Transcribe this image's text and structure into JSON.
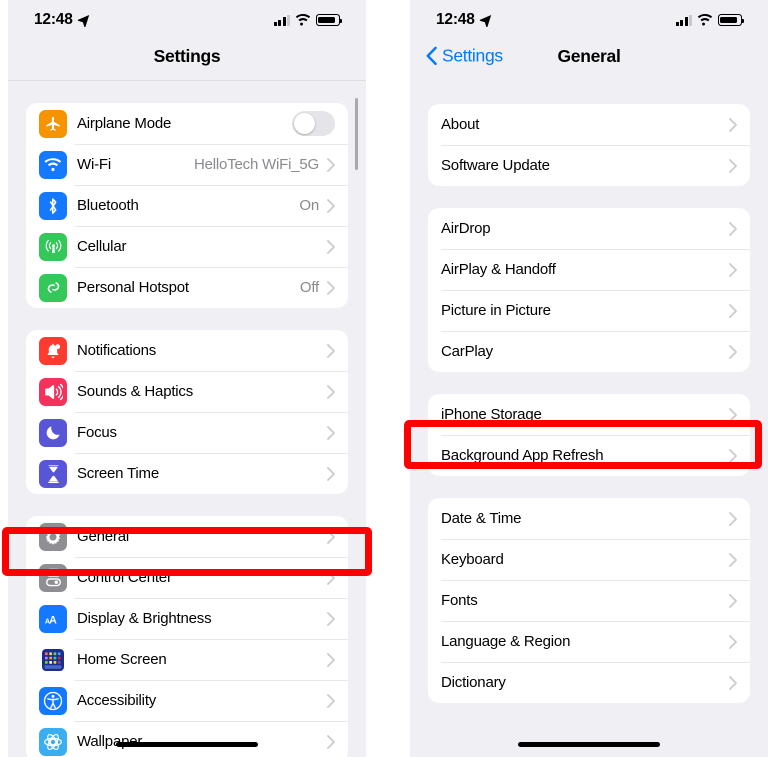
{
  "colors": {
    "accent_blue": "#007aff",
    "highlight_red": "#ff0000",
    "page_background": "#efeff4",
    "card_background": "#ffffff",
    "value_gray": "#8a8a8e"
  },
  "left_phone": {
    "status_bar": {
      "time": "12:48",
      "location_icon": "location-arrow-icon",
      "signal_icon": "cellular-bars-icon",
      "wifi_icon": "wifi-icon",
      "battery_icon": "battery-icon"
    },
    "nav": {
      "title": "Settings"
    },
    "groups": [
      {
        "rows": [
          {
            "label": "Airplane Mode",
            "icon": "airplane-icon",
            "icon_color": "#f59300",
            "control": "toggle",
            "toggle_on": false
          },
          {
            "label": "Wi-Fi",
            "icon": "wifi-icon",
            "icon_color": "#1479ff",
            "value": "HelloTech WiFi_5G",
            "control": "chevron"
          },
          {
            "label": "Bluetooth",
            "icon": "bluetooth-icon",
            "icon_color": "#1479ff",
            "value": "On",
            "control": "chevron"
          },
          {
            "label": "Cellular",
            "icon": "cellular-antenna-icon",
            "icon_color": "#34c759",
            "value": "",
            "control": "chevron"
          },
          {
            "label": "Personal Hotspot",
            "icon": "hotspot-link-icon",
            "icon_color": "#34c759",
            "value": "Off",
            "control": "chevron"
          }
        ]
      },
      {
        "rows": [
          {
            "label": "Notifications",
            "icon": "bell-icon",
            "icon_color": "#ff3b30",
            "value": "",
            "control": "chevron"
          },
          {
            "label": "Sounds & Haptics",
            "icon": "speaker-icon",
            "icon_color": "#f4325c",
            "value": "",
            "control": "chevron"
          },
          {
            "label": "Focus",
            "icon": "moon-icon",
            "icon_color": "#5856d6",
            "value": "",
            "control": "chevron"
          },
          {
            "label": "Screen Time",
            "icon": "hourglass-icon",
            "icon_color": "#5856d6",
            "value": "",
            "control": "chevron"
          }
        ]
      },
      {
        "rows": [
          {
            "label": "General",
            "icon": "gear-icon",
            "icon_color": "#8e8e93",
            "value": "",
            "control": "chevron",
            "highlighted": true
          },
          {
            "label": "Control Center",
            "icon": "control-center-icon",
            "icon_color": "#8e8e93",
            "value": "",
            "control": "chevron"
          },
          {
            "label": "Display & Brightness",
            "icon": "display-brightness-icon",
            "icon_color": "#1479ff",
            "value": "",
            "control": "chevron"
          },
          {
            "label": "Home Screen",
            "icon": "home-screen-grid-icon",
            "icon_color": "#1479ff",
            "value": "",
            "control": "chevron"
          },
          {
            "label": "Accessibility",
            "icon": "accessibility-icon",
            "icon_color": "#1479ff",
            "value": "",
            "control": "chevron"
          },
          {
            "label": "Wallpaper",
            "icon": "wallpaper-icon",
            "icon_color": "#3aaef0",
            "value": "",
            "control": "chevron"
          }
        ]
      }
    ]
  },
  "right_phone": {
    "status_bar": {
      "time": "12:48",
      "location_icon": "location-arrow-icon",
      "signal_icon": "cellular-bars-icon",
      "wifi_icon": "wifi-icon",
      "battery_icon": "battery-icon"
    },
    "nav": {
      "back_label": "Settings",
      "back_icon": "chevron-left-icon",
      "title": "General"
    },
    "groups": [
      {
        "rows": [
          {
            "label": "About",
            "control": "chevron"
          },
          {
            "label": "Software Update",
            "control": "chevron"
          }
        ]
      },
      {
        "rows": [
          {
            "label": "AirDrop",
            "control": "chevron"
          },
          {
            "label": "AirPlay & Handoff",
            "control": "chevron"
          },
          {
            "label": "Picture in Picture",
            "control": "chevron"
          },
          {
            "label": "CarPlay",
            "control": "chevron"
          }
        ]
      },
      {
        "rows": [
          {
            "label": "iPhone Storage",
            "control": "chevron",
            "highlighted": true
          },
          {
            "label": "Background App Refresh",
            "control": "chevron"
          }
        ]
      },
      {
        "rows": [
          {
            "label": "Date & Time",
            "control": "chevron"
          },
          {
            "label": "Keyboard",
            "control": "chevron"
          },
          {
            "label": "Fonts",
            "control": "chevron"
          },
          {
            "label": "Language & Region",
            "control": "chevron"
          },
          {
            "label": "Dictionary",
            "control": "chevron"
          }
        ]
      }
    ]
  }
}
